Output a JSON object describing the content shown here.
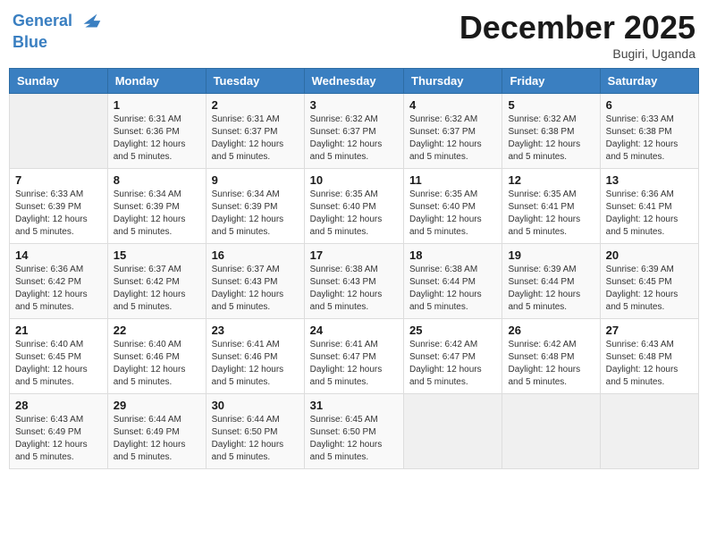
{
  "header": {
    "logo_line1": "General",
    "logo_line2": "Blue",
    "month": "December 2025",
    "location": "Bugiri, Uganda"
  },
  "weekdays": [
    "Sunday",
    "Monday",
    "Tuesday",
    "Wednesday",
    "Thursday",
    "Friday",
    "Saturday"
  ],
  "weeks": [
    [
      {
        "day": "",
        "info": ""
      },
      {
        "day": "1",
        "info": "Sunrise: 6:31 AM\nSunset: 6:36 PM\nDaylight: 12 hours\nand 5 minutes."
      },
      {
        "day": "2",
        "info": "Sunrise: 6:31 AM\nSunset: 6:37 PM\nDaylight: 12 hours\nand 5 minutes."
      },
      {
        "day": "3",
        "info": "Sunrise: 6:32 AM\nSunset: 6:37 PM\nDaylight: 12 hours\nand 5 minutes."
      },
      {
        "day": "4",
        "info": "Sunrise: 6:32 AM\nSunset: 6:37 PM\nDaylight: 12 hours\nand 5 minutes."
      },
      {
        "day": "5",
        "info": "Sunrise: 6:32 AM\nSunset: 6:38 PM\nDaylight: 12 hours\nand 5 minutes."
      },
      {
        "day": "6",
        "info": "Sunrise: 6:33 AM\nSunset: 6:38 PM\nDaylight: 12 hours\nand 5 minutes."
      }
    ],
    [
      {
        "day": "7",
        "info": "Sunrise: 6:33 AM\nSunset: 6:39 PM\nDaylight: 12 hours\nand 5 minutes."
      },
      {
        "day": "8",
        "info": "Sunrise: 6:34 AM\nSunset: 6:39 PM\nDaylight: 12 hours\nand 5 minutes."
      },
      {
        "day": "9",
        "info": "Sunrise: 6:34 AM\nSunset: 6:39 PM\nDaylight: 12 hours\nand 5 minutes."
      },
      {
        "day": "10",
        "info": "Sunrise: 6:35 AM\nSunset: 6:40 PM\nDaylight: 12 hours\nand 5 minutes."
      },
      {
        "day": "11",
        "info": "Sunrise: 6:35 AM\nSunset: 6:40 PM\nDaylight: 12 hours\nand 5 minutes."
      },
      {
        "day": "12",
        "info": "Sunrise: 6:35 AM\nSunset: 6:41 PM\nDaylight: 12 hours\nand 5 minutes."
      },
      {
        "day": "13",
        "info": "Sunrise: 6:36 AM\nSunset: 6:41 PM\nDaylight: 12 hours\nand 5 minutes."
      }
    ],
    [
      {
        "day": "14",
        "info": "Sunrise: 6:36 AM\nSunset: 6:42 PM\nDaylight: 12 hours\nand 5 minutes."
      },
      {
        "day": "15",
        "info": "Sunrise: 6:37 AM\nSunset: 6:42 PM\nDaylight: 12 hours\nand 5 minutes."
      },
      {
        "day": "16",
        "info": "Sunrise: 6:37 AM\nSunset: 6:43 PM\nDaylight: 12 hours\nand 5 minutes."
      },
      {
        "day": "17",
        "info": "Sunrise: 6:38 AM\nSunset: 6:43 PM\nDaylight: 12 hours\nand 5 minutes."
      },
      {
        "day": "18",
        "info": "Sunrise: 6:38 AM\nSunset: 6:44 PM\nDaylight: 12 hours\nand 5 minutes."
      },
      {
        "day": "19",
        "info": "Sunrise: 6:39 AM\nSunset: 6:44 PM\nDaylight: 12 hours\nand 5 minutes."
      },
      {
        "day": "20",
        "info": "Sunrise: 6:39 AM\nSunset: 6:45 PM\nDaylight: 12 hours\nand 5 minutes."
      }
    ],
    [
      {
        "day": "21",
        "info": "Sunrise: 6:40 AM\nSunset: 6:45 PM\nDaylight: 12 hours\nand 5 minutes."
      },
      {
        "day": "22",
        "info": "Sunrise: 6:40 AM\nSunset: 6:46 PM\nDaylight: 12 hours\nand 5 minutes."
      },
      {
        "day": "23",
        "info": "Sunrise: 6:41 AM\nSunset: 6:46 PM\nDaylight: 12 hours\nand 5 minutes."
      },
      {
        "day": "24",
        "info": "Sunrise: 6:41 AM\nSunset: 6:47 PM\nDaylight: 12 hours\nand 5 minutes."
      },
      {
        "day": "25",
        "info": "Sunrise: 6:42 AM\nSunset: 6:47 PM\nDaylight: 12 hours\nand 5 minutes."
      },
      {
        "day": "26",
        "info": "Sunrise: 6:42 AM\nSunset: 6:48 PM\nDaylight: 12 hours\nand 5 minutes."
      },
      {
        "day": "27",
        "info": "Sunrise: 6:43 AM\nSunset: 6:48 PM\nDaylight: 12 hours\nand 5 minutes."
      }
    ],
    [
      {
        "day": "28",
        "info": "Sunrise: 6:43 AM\nSunset: 6:49 PM\nDaylight: 12 hours\nand 5 minutes."
      },
      {
        "day": "29",
        "info": "Sunrise: 6:44 AM\nSunset: 6:49 PM\nDaylight: 12 hours\nand 5 minutes."
      },
      {
        "day": "30",
        "info": "Sunrise: 6:44 AM\nSunset: 6:50 PM\nDaylight: 12 hours\nand 5 minutes."
      },
      {
        "day": "31",
        "info": "Sunrise: 6:45 AM\nSunset: 6:50 PM\nDaylight: 12 hours\nand 5 minutes."
      },
      {
        "day": "",
        "info": ""
      },
      {
        "day": "",
        "info": ""
      },
      {
        "day": "",
        "info": ""
      }
    ]
  ]
}
